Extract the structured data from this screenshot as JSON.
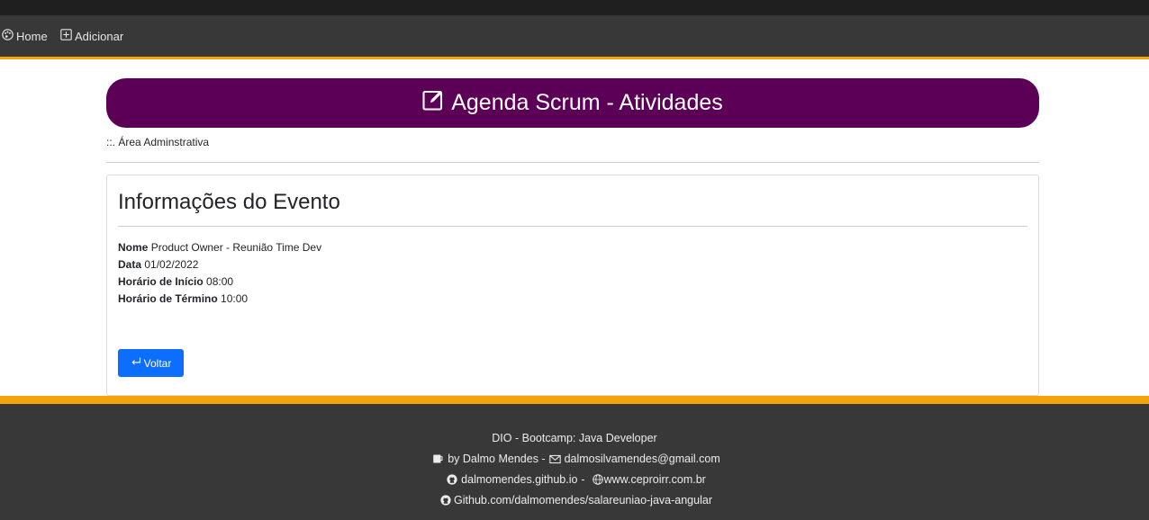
{
  "nav": {
    "home_label": "Home",
    "add_label": "Adicionar",
    "home_icon": "palette-icon",
    "add_icon": "plus-square-icon"
  },
  "header": {
    "title": "Agenda Scrum - Atividades",
    "title_icon": "pencil-square-icon",
    "subtitle": "::. Área Adminstrativa"
  },
  "event": {
    "heading": "Informações do Evento",
    "fields": [
      {
        "label": "Nome",
        "value": "Product Owner - Reunião Time Dev"
      },
      {
        "label": "Data",
        "value": "01/02/2022"
      },
      {
        "label": "Horário de Início",
        "value": "08:00"
      },
      {
        "label": "Horário de Término",
        "value": "10:00"
      }
    ],
    "back_label": "Voltar",
    "back_icon": "return-arrow-icon"
  },
  "footer": {
    "line1": "DIO - Bootcamp: Java Developer",
    "author": "by Dalmo Mendes -",
    "email": "dalmosilvamendes@gmail.com",
    "site1": "dalmomendes.github.io",
    "separator": "-",
    "site2": "www.ceproirr.com.br",
    "repo": "Github.com/dalmomendes/salareuniao-java-angular"
  },
  "colors": {
    "nav_bg": "#383838",
    "accent": "#f5a30a",
    "banner": "#5c0057",
    "button": "#0d6efd"
  }
}
